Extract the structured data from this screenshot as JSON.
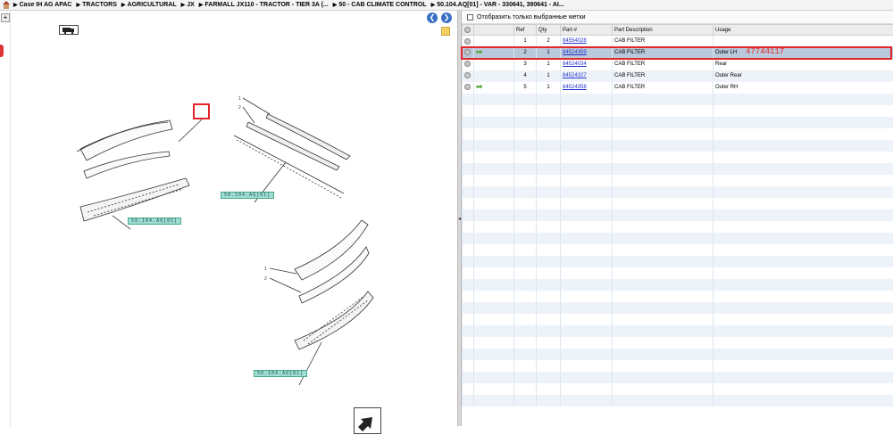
{
  "breadcrumb": [
    "Case IH AG APAC",
    "TRACTORS",
    "AGRICULTURAL",
    "JX",
    "FARMALL JX110 - TRACTOR - TIER 3A (...",
    "50 - CAB CLIMATE CONTROL",
    "50.104.AQ[01] - VAR - 330641, 390641 - AI..."
  ],
  "filter": {
    "label": "Отобразить только выбранные метки"
  },
  "table": {
    "headers": [
      "Ref",
      "Qty",
      "Part #",
      "Part Description",
      "Usage"
    ],
    "rows": [
      {
        "ref": "1",
        "qty": "2",
        "part": "84554028",
        "desc": "CAB FILTER",
        "usage": "",
        "arrow": false
      },
      {
        "ref": "2",
        "qty": "1",
        "part": "84524359",
        "desc": "CAB FILTER",
        "usage": "Outer LH",
        "arrow": true
      },
      {
        "ref": "3",
        "qty": "1",
        "part": "84524034",
        "desc": "CAB FILTER",
        "usage": "Rear",
        "arrow": false
      },
      {
        "ref": "4",
        "qty": "1",
        "part": "84524327",
        "desc": "CAB FILTER",
        "usage": "Outer Rear",
        "arrow": false
      },
      {
        "ref": "5",
        "qty": "1",
        "part": "84524358",
        "desc": "CAB FILTER",
        "usage": "Outer RH",
        "arrow": true
      }
    ]
  },
  "annotation": "47744117",
  "callouts": [
    "50.104.AQ[01]",
    "50.104.AQ[01]",
    "50.104.AQ[01]"
  ],
  "colors": {
    "highlight": "#e2252a",
    "selected_row": "#b9c9dc",
    "link": "#2233cc"
  }
}
